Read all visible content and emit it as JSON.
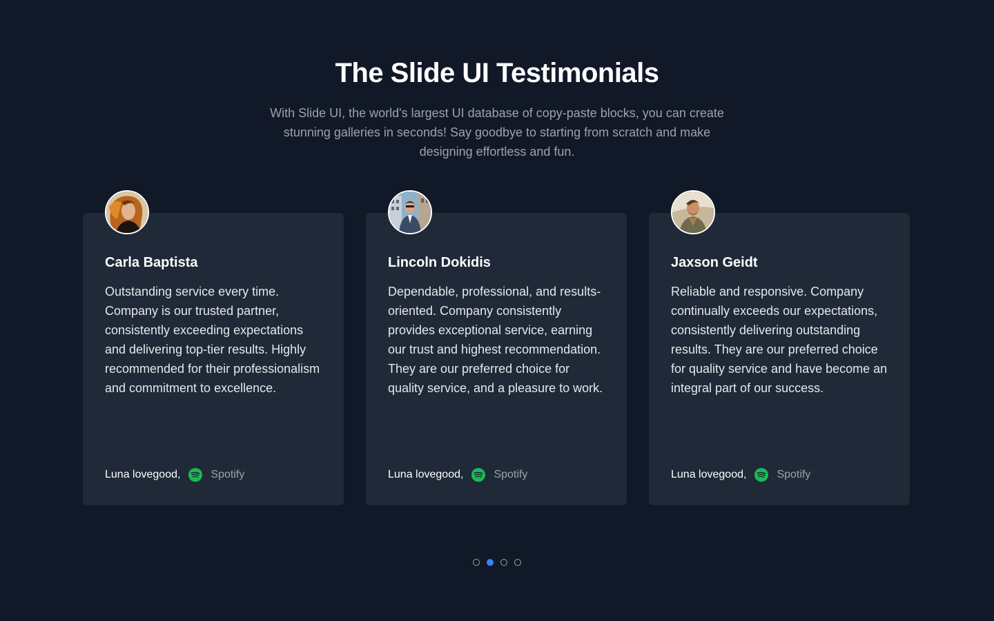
{
  "header": {
    "title": "The Slide UI Testimonials",
    "subtitle": "With Slide UI, the world's largest UI database of copy-paste blocks, you can create stunning galleries in seconds! Say goodbye to starting from scratch and make designing effortless and fun."
  },
  "testimonials": [
    {
      "name": "Carla Baptista",
      "quote": "Outstanding service every time. Company is our trusted partner, consistently exceeding expectations and delivering top-tier results. Highly recommended for their professionalism and commitment to excellence.",
      "author": "Luna lovegood,",
      "company": "Spotify",
      "company_icon": "spotify-icon"
    },
    {
      "name": "Lincoln Dokidis",
      "quote": "Dependable, professional, and results-oriented. Company consistently provides exceptional service, earning our trust and highest recommendation. They are our preferred choice for quality service, and a pleasure to work.",
      "author": "Luna lovegood,",
      "company": "Spotify",
      "company_icon": "spotify-icon"
    },
    {
      "name": "Jaxson Geidt",
      "quote": "Reliable and responsive. Company continually exceeds our expectations, consistently delivering outstanding results. They are our preferred choice for quality service and have become an integral part of our success.",
      "author": "Luna lovegood,",
      "company": "Spotify",
      "company_icon": "spotify-icon"
    }
  ],
  "pagination": {
    "count": 4,
    "active_index": 1
  },
  "colors": {
    "background": "#111827",
    "card": "#1f2937",
    "accent": "#3b82f6",
    "spotify": "#1db954",
    "muted_text": "#9ca3af"
  }
}
